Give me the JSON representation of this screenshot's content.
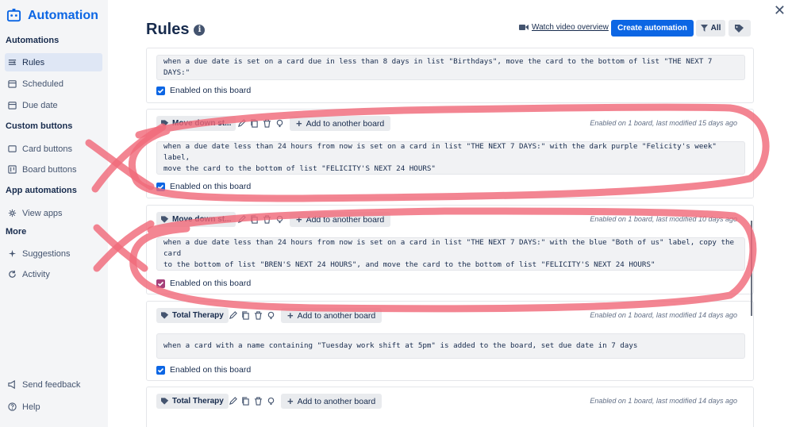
{
  "app": {
    "title": "Automation"
  },
  "sidebar": {
    "sections": [
      {
        "title": "Automations",
        "items": [
          {
            "label": "Rules",
            "icon": "rules-icon",
            "active": true
          },
          {
            "label": "Scheduled",
            "icon": "calendar-icon"
          },
          {
            "label": "Due date",
            "icon": "calendar-icon"
          }
        ]
      },
      {
        "title": "Custom buttons",
        "items": [
          {
            "label": "Card buttons",
            "icon": "card-icon"
          },
          {
            "label": "Board buttons",
            "icon": "board-icon"
          }
        ]
      },
      {
        "title": "App automations",
        "items": [
          {
            "label": "View apps",
            "icon": "gear-icon"
          }
        ]
      },
      {
        "title": "More",
        "items": [
          {
            "label": "Suggestions",
            "icon": "sparkle-icon"
          },
          {
            "label": "Activity",
            "icon": "refresh-icon"
          }
        ]
      }
    ],
    "footer": [
      {
        "label": "Send feedback",
        "icon": "megaphone-icon"
      },
      {
        "label": "Help",
        "icon": "help-icon"
      }
    ]
  },
  "header": {
    "title": "Rules",
    "watch_label": "Watch video overview",
    "create_label": "Create automation",
    "filter_label": "All"
  },
  "rules": [
    {
      "text": "when a due date is set on a card due in less than 8 days in list \"Birthdays\", move the card to the bottom of list \"THE NEXT 7 DAYS:\"",
      "enabled_label": "Enabled on this board",
      "enabled": true
    },
    {
      "name": "Move down st...",
      "add_label": "Add to another board",
      "meta": "Enabled on 1 board, last modified 15 days ago",
      "text_line1": "when a due date less than 24 hours from now is set on a card in list \"THE NEXT 7 DAYS:\" with the dark purple \"Felicity's week\" label,",
      "text_line2": "move the card to the bottom of list \"FELICITY'S NEXT 24 HOURS\"",
      "enabled_label": "Enabled on this board",
      "enabled": true
    },
    {
      "name": "Move down st...",
      "add_label": "Add to another board",
      "meta": "Enabled on 1 board, last modified 10 days ago",
      "text_line1": "when a due date less than 24 hours from now is set on a card in list \"THE NEXT 7 DAYS:\" with the blue \"Both of us\" label, copy the card",
      "text_line2": "to the bottom of list \"BREN'S NEXT 24 HOURS\", and move the card to the bottom of list \"FELICITY'S NEXT 24 HOURS\"",
      "enabled_label": "Enabled on this board",
      "enabled": true
    },
    {
      "name": "Total Therapy",
      "add_label": "Add to another board",
      "meta": "Enabled on 1 board, last modified 14 days ago",
      "text": "when a card with a name containing \"Tuesday work shift at 5pm\" is added to the board, set due date in 7 days",
      "enabled_label": "Enabled on this board",
      "enabled": true
    },
    {
      "name": "Total Therapy",
      "add_label": "Add to another board",
      "meta": "Enabled on 1 board, last modified 14 days ago"
    }
  ],
  "colors": {
    "accent": "#0c66e4",
    "ink": "#f06a7a"
  }
}
